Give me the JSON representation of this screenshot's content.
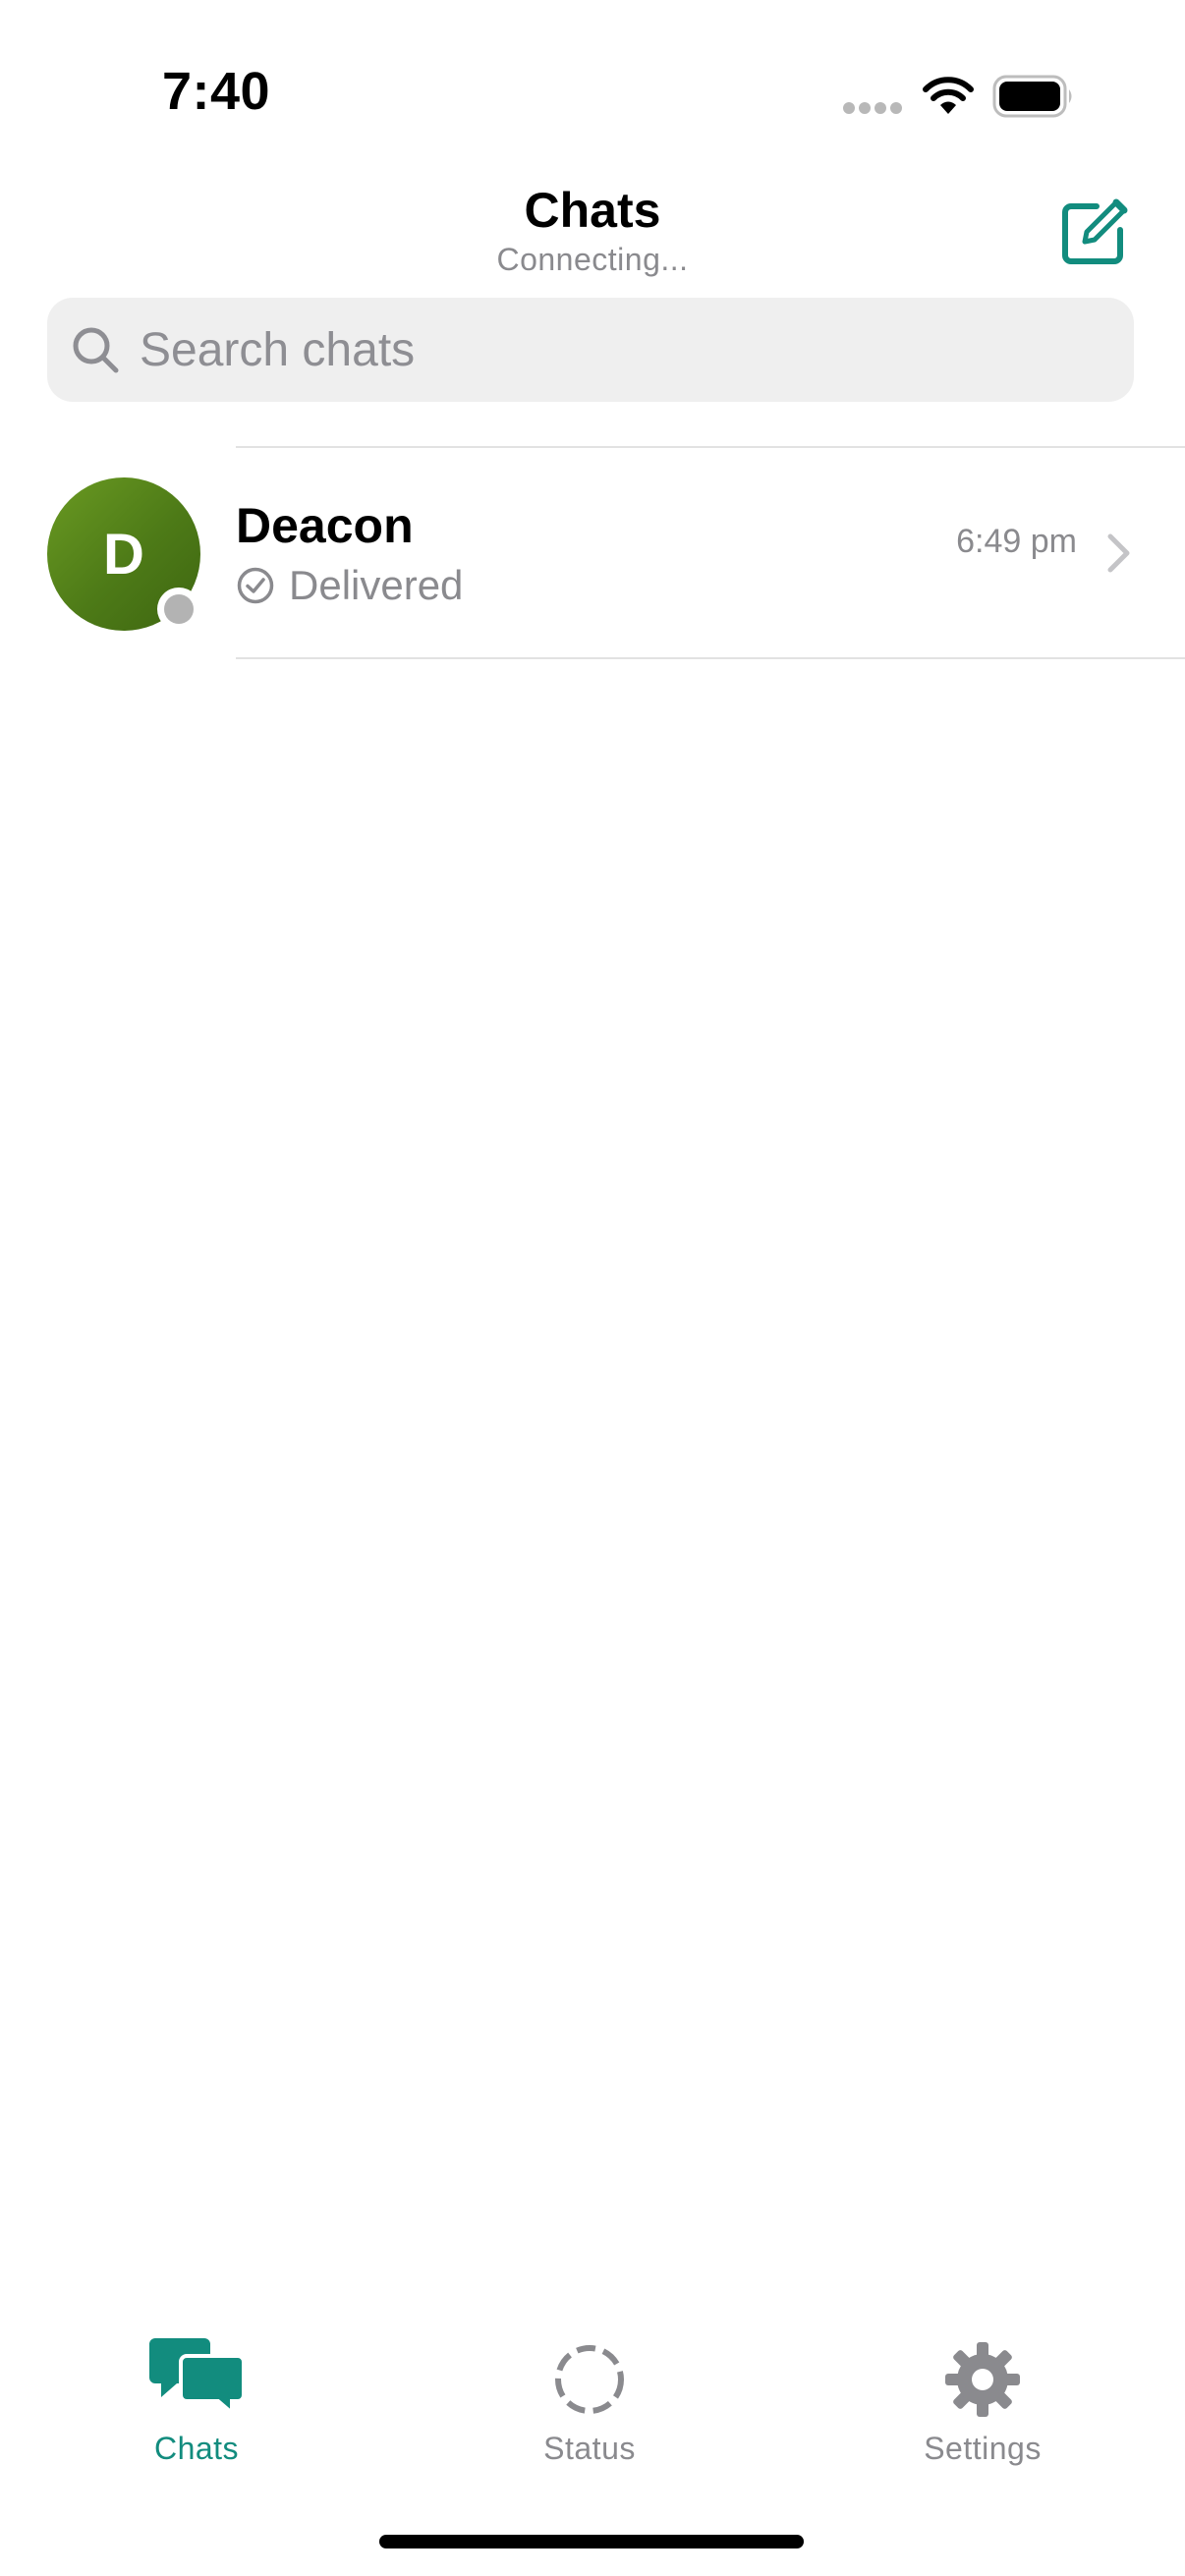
{
  "status_bar": {
    "time": "7:40"
  },
  "header": {
    "title": "Chats",
    "subtitle": "Connecting..."
  },
  "search": {
    "placeholder": "Search chats",
    "value": ""
  },
  "chats": [
    {
      "initial": "D",
      "name": "Deacon",
      "status": "Delivered",
      "time": "6:49 pm"
    }
  ],
  "tabs": [
    {
      "label": "Chats",
      "active": true
    },
    {
      "label": "Status",
      "active": false
    },
    {
      "label": "Settings",
      "active": false
    }
  ],
  "colors": {
    "accent": "#128c7e",
    "inactive": "#8a8a8e",
    "avatar": "#5a8a1c",
    "search_bg": "#efefef"
  }
}
